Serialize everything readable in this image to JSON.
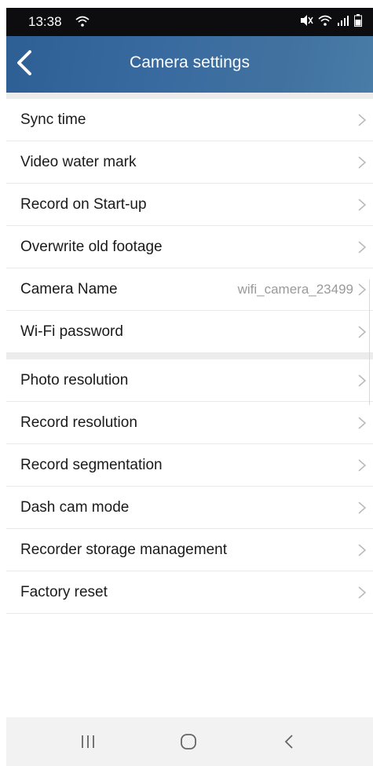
{
  "status_bar": {
    "time": "13:38",
    "icons": [
      "wifi-icon",
      "mute-icon",
      "wifi-signal-icon",
      "cell-signal-icon",
      "battery-icon"
    ]
  },
  "header": {
    "title": "Camera settings",
    "back_icon": "chevron-left-icon",
    "accent_color": "#3a6ba0"
  },
  "settings": {
    "group1": [
      {
        "label": "Sync time"
      },
      {
        "label": "Video water mark"
      },
      {
        "label": "Record on Start-up"
      },
      {
        "label": "Overwrite old footage"
      },
      {
        "label": "Camera Name",
        "value": "wifi_camera_23499"
      },
      {
        "label": "Wi-Fi password"
      }
    ],
    "group2": [
      {
        "label": "Photo resolution"
      },
      {
        "label": "Record resolution"
      },
      {
        "label": "Record segmentation"
      },
      {
        "label": "Dash cam mode"
      },
      {
        "label": "Recorder storage management"
      },
      {
        "label": "Factory reset"
      }
    ]
  },
  "nav_bar": {
    "buttons": [
      "recent-apps-icon",
      "home-icon",
      "back-icon"
    ]
  }
}
